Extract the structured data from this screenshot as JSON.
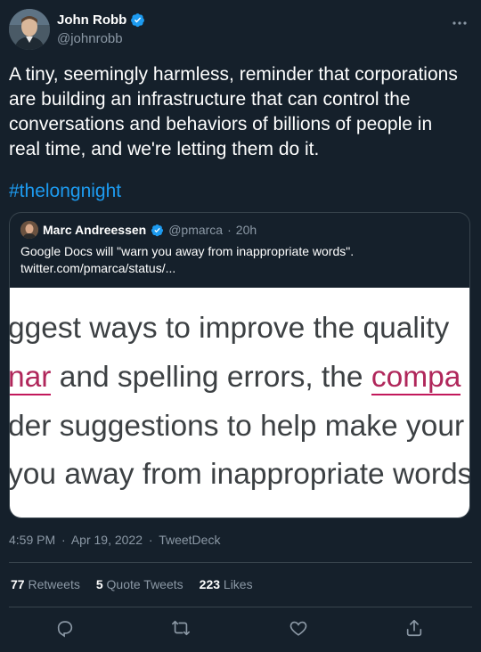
{
  "author": {
    "name": "John Robb",
    "handle": "@johnrobb",
    "verified": true
  },
  "tweet": {
    "text": "A tiny, seemingly harmless, reminder that corporations are building an infrastructure that can control the conversations and behaviors of billions of people in real time, and we're letting them do it.",
    "hashtag": "#thelongnight"
  },
  "quoted": {
    "name": "Marc Andreessen",
    "handle": "@pmarca",
    "dot": "·",
    "time": "20h",
    "text_line1": "Google Docs will \"warn you away from inappropriate words\".",
    "text_line2": "twitter.com/pmarca/status/...",
    "image_lines": {
      "line1": "ggest ways to improve the quality",
      "line2_pre": "nar",
      "line2_mid": " and spelling errors, the ",
      "line2_post": "compa",
      "line3": "der suggestions to help make your",
      "line4": "you away from inappropriate words"
    }
  },
  "meta": {
    "time": "4:59 PM",
    "sep1": "·",
    "date": "Apr 19, 2022",
    "sep2": "·",
    "source": "TweetDeck"
  },
  "stats": {
    "retweets_count": "77",
    "retweets_label": "Retweets",
    "quotes_count": "5",
    "quotes_label": "Quote Tweets",
    "likes_count": "223",
    "likes_label": "Likes"
  },
  "colors": {
    "background": "#15202b",
    "link": "#1d9bf0",
    "secondary_text": "#8b98a5",
    "border": "#38444d",
    "verified": "#1d9bf0"
  },
  "icons": [
    "verified-badge-icon",
    "more-icon",
    "reply-icon",
    "retweet-icon",
    "like-icon",
    "share-icon"
  ]
}
